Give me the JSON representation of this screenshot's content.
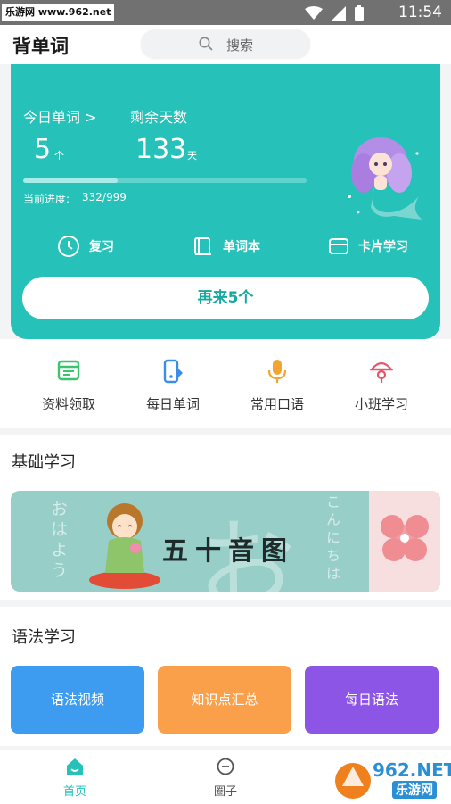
{
  "status_bar": {
    "watermark": "乐游网 www.962.net",
    "time": "11:54"
  },
  "header": {
    "title": "背单词",
    "search_placeholder": "搜索"
  },
  "study_card": {
    "today_label": "今日单词 >",
    "today_count": "5",
    "today_unit": "个",
    "remaining_label": "剩余天数",
    "remaining_days": "133",
    "remaining_unit": "天",
    "progress_label": "当前进度:",
    "progress_value": "332/999",
    "progress_fraction": 0.332,
    "actions": [
      {
        "label": "复习",
        "icon": "clock-icon"
      },
      {
        "label": "单词本",
        "icon": "book-icon"
      },
      {
        "label": "卡片学习",
        "icon": "card-icon"
      }
    ],
    "again_button": "再来5个",
    "accent_color": "#26c1b8"
  },
  "quick_entries": [
    {
      "label": "资料领取",
      "icon": "document-icon",
      "color": "#3cc56e"
    },
    {
      "label": "每日单词",
      "icon": "phone-dictionary-icon",
      "color": "#3a8de8"
    },
    {
      "label": "常用口语",
      "icon": "microphone-icon",
      "color": "#f3a531"
    },
    {
      "label": "小班学习",
      "icon": "class-icon",
      "color": "#e8546a"
    }
  ],
  "basic_section": {
    "title": "基础学习",
    "banner": {
      "title": "五十音图",
      "left_text": "おはよう",
      "right_text": "こんにちは",
      "big_char": "お"
    }
  },
  "grammar_section": {
    "title": "语法学习",
    "buttons": [
      {
        "label": "语法视频",
        "color": "#3d9bf0"
      },
      {
        "label": "知识点汇总",
        "color": "#fba04a"
      },
      {
        "label": "每日语法",
        "color": "#8c55e6"
      }
    ]
  },
  "bottom_nav": {
    "tabs": [
      {
        "label": "首页",
        "icon": "home-icon",
        "active": true
      },
      {
        "label": "圈子",
        "icon": "chat-icon",
        "active": false
      }
    ],
    "watermark_logo": "962.NET",
    "watermark_sub": "乐游网"
  }
}
